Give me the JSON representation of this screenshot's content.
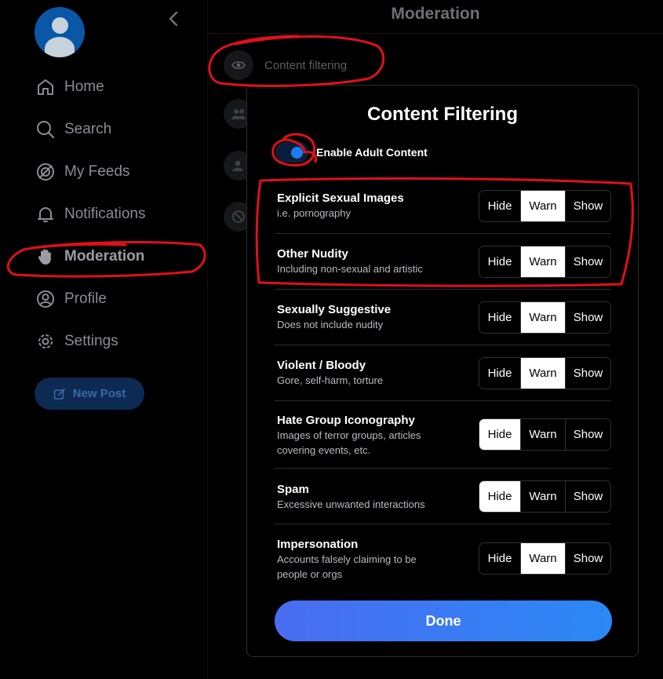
{
  "colors": {
    "accent": "#2b88f5",
    "annotation": "#e0101a",
    "background": "#000000"
  },
  "sidebar": {
    "avatar_icon": "user-avatar",
    "back_icon": "chevron-left-icon",
    "items": [
      {
        "label": "Home",
        "icon": "home-icon"
      },
      {
        "label": "Search",
        "icon": "search-icon"
      },
      {
        "label": "My Feeds",
        "icon": "feeds-icon"
      },
      {
        "label": "Notifications",
        "icon": "bell-icon"
      },
      {
        "label": "Moderation",
        "icon": "hand-icon",
        "active": true
      },
      {
        "label": "Profile",
        "icon": "profile-icon"
      },
      {
        "label": "Settings",
        "icon": "gear-icon"
      }
    ],
    "new_post_label": "New Post"
  },
  "main": {
    "title": "Moderation",
    "rows": [
      {
        "label": "Content filtering",
        "icon": "eye-icon"
      }
    ]
  },
  "modal": {
    "title": "Content Filtering",
    "adult_toggle": {
      "label": "Enable Adult Content",
      "on": true
    },
    "options": [
      "Hide",
      "Warn",
      "Show"
    ],
    "prefs": [
      {
        "title": "Explicit Sexual Images",
        "desc": "i.e. pornography",
        "selected": "Warn"
      },
      {
        "title": "Other Nudity",
        "desc": "Including non-sexual and artistic",
        "selected": "Warn"
      },
      {
        "title": "Sexually Suggestive",
        "desc": "Does not include nudity",
        "selected": "Warn"
      },
      {
        "title": "Violent / Bloody",
        "desc": "Gore, self-harm, torture",
        "selected": "Warn"
      },
      {
        "title": "Hate Group Iconography",
        "desc": "Images of terror groups, articles covering events, etc.",
        "selected": "Hide"
      },
      {
        "title": "Spam",
        "desc": "Excessive unwanted interactions",
        "selected": "Hide"
      },
      {
        "title": "Impersonation",
        "desc": "Accounts falsely claiming to be people or orgs",
        "selected": "Warn"
      }
    ],
    "done_label": "Done"
  }
}
